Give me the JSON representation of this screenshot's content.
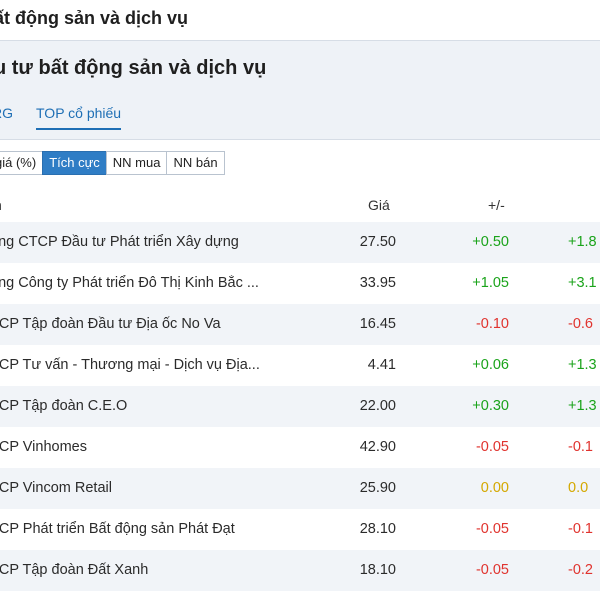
{
  "header": {
    "title": "ất động sản và dịch vụ"
  },
  "panel": {
    "title": "u tư bất động sản và dịch vụ",
    "tabs": [
      {
        "label": "RG",
        "active": false
      },
      {
        "label": "TOP cổ phiếu",
        "active": true
      }
    ],
    "filters": [
      {
        "label": "giá (%)",
        "active": false
      },
      {
        "label": "Tích cực",
        "active": true
      },
      {
        "label": "NN mua",
        "active": false
      },
      {
        "label": "NN bán",
        "active": false
      }
    ],
    "columns": {
      "name": "n",
      "price": "Giá",
      "change": "+/-"
    },
    "rows": [
      {
        "name": "ông CTCP Đầu tư Phát triển Xây dựng",
        "price": "27.50",
        "change": "+0.50",
        "pct": "+1.8",
        "trend": "up"
      },
      {
        "name": "ông Công ty Phát triển Đô Thị Kinh Bắc ...",
        "price": "33.95",
        "change": "+1.05",
        "pct": "+3.1",
        "trend": "up"
      },
      {
        "name": "TCP Tập đoàn Đầu tư Địa ốc No Va",
        "price": "16.45",
        "change": "-0.10",
        "pct": "-0.6",
        "trend": "down"
      },
      {
        "name": "TCP Tư vấn - Thương mại - Dịch vụ Địa...",
        "price": "4.41",
        "change": "+0.06",
        "pct": "+1.3",
        "trend": "up"
      },
      {
        "name": "TCP Tập đoàn C.E.O",
        "price": "22.00",
        "change": "+0.30",
        "pct": "+1.3",
        "trend": "up"
      },
      {
        "name": "TCP Vinhomes",
        "price": "42.90",
        "change": "-0.05",
        "pct": "-0.1",
        "trend": "down"
      },
      {
        "name": "TCP Vincom Retail",
        "price": "25.90",
        "change": "0.00",
        "pct": "0.0",
        "trend": "flat"
      },
      {
        "name": "TCP Phát triển Bất động sản Phát Đạt",
        "price": "28.10",
        "change": "-0.05",
        "pct": "-0.1",
        "trend": "down"
      },
      {
        "name": "TCP Tập đoàn Đất Xanh",
        "price": "18.10",
        "change": "-0.05",
        "pct": "-0.2",
        "trend": "down"
      }
    ]
  },
  "colors": {
    "up": "#1aa31a",
    "down": "#e0332e",
    "flat": "#d4a800",
    "accent": "#2f7dc5"
  }
}
